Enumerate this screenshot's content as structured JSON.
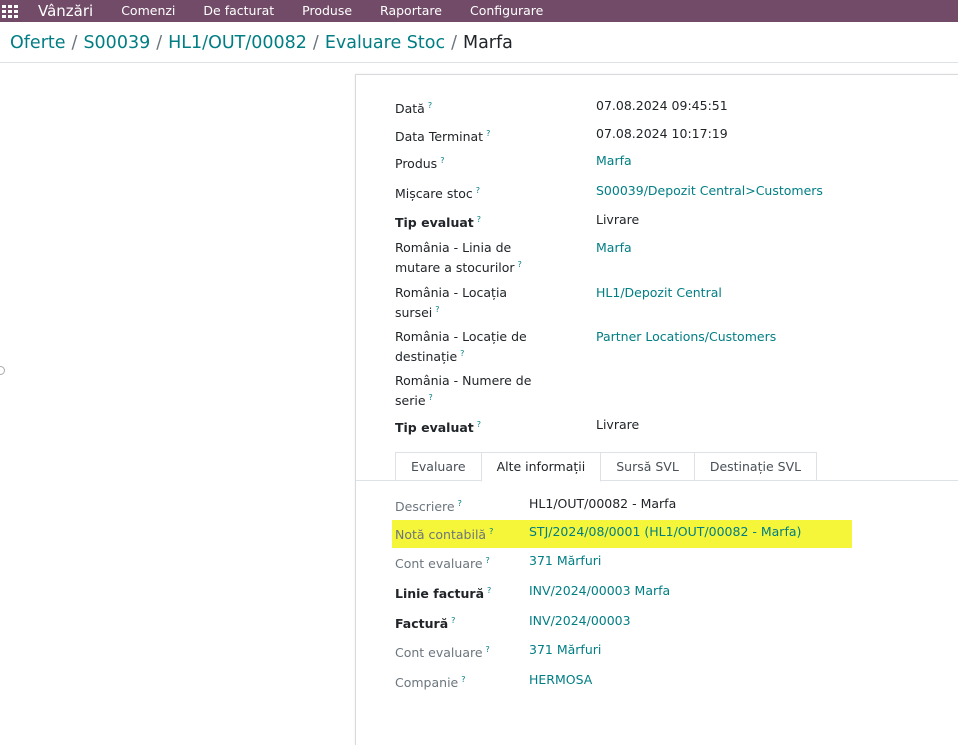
{
  "topbar": {
    "app_name": "Vânzări",
    "menu": [
      "Comenzi",
      "De facturat",
      "Produse",
      "Raportare",
      "Configurare"
    ]
  },
  "breadcrumb": {
    "items": [
      "Oferte",
      "S00039",
      "HL1/OUT/00082",
      "Evaluare Stoc"
    ],
    "current": "Marfa",
    "separator": "/"
  },
  "help_marker": "?",
  "fields": [
    {
      "label": "Dată",
      "value": "07.08.2024 09:45:51"
    },
    {
      "label": "Data Terminat",
      "value": "07.08.2024 10:17:19"
    },
    {
      "label": "Produs",
      "value": "Marfa"
    },
    {
      "label": "Mișcare stoc",
      "value": "S00039/Depozit Central>Customers"
    },
    {
      "label": "Tip evaluat",
      "value": "Livrare"
    },
    {
      "label": "România - Linia de mutare a stocurilor",
      "value": "Marfa"
    },
    {
      "label": "România - Locația sursei",
      "value": "HL1/Depozit Central"
    },
    {
      "label": "România - Locație de destinație",
      "value": "Partner Locations/Customers"
    },
    {
      "label": "România - Numere de serie",
      "value": ""
    },
    {
      "label": "Tip evaluat",
      "value": "Livrare"
    }
  ],
  "tabs": [
    {
      "label": "Evaluare",
      "active": false
    },
    {
      "label": "Alte informații",
      "active": true
    },
    {
      "label": "Sursă SVL",
      "active": false
    },
    {
      "label": "Destinație SVL",
      "active": false
    }
  ],
  "tab_fields": [
    {
      "label": "Descriere",
      "value": "HL1/OUT/00082 - Marfa"
    },
    {
      "label": "Notă contabilă",
      "value": "STJ/2024/08/0001 (HL1/OUT/00082 - Marfa)"
    },
    {
      "label": "Cont evaluare",
      "value": "371 Mărfuri"
    },
    {
      "label": "Linie factură",
      "value": "INV/2024/00003 Marfa"
    },
    {
      "label": "Factură",
      "value": "INV/2024/00003"
    },
    {
      "label": "Cont evaluare",
      "value": "371 Mărfuri"
    },
    {
      "label": "Companie",
      "value": "HERMOSA"
    }
  ],
  "colors": {
    "navbar": "#714B67",
    "link": "#017e84",
    "highlight": "#f5f53a"
  }
}
